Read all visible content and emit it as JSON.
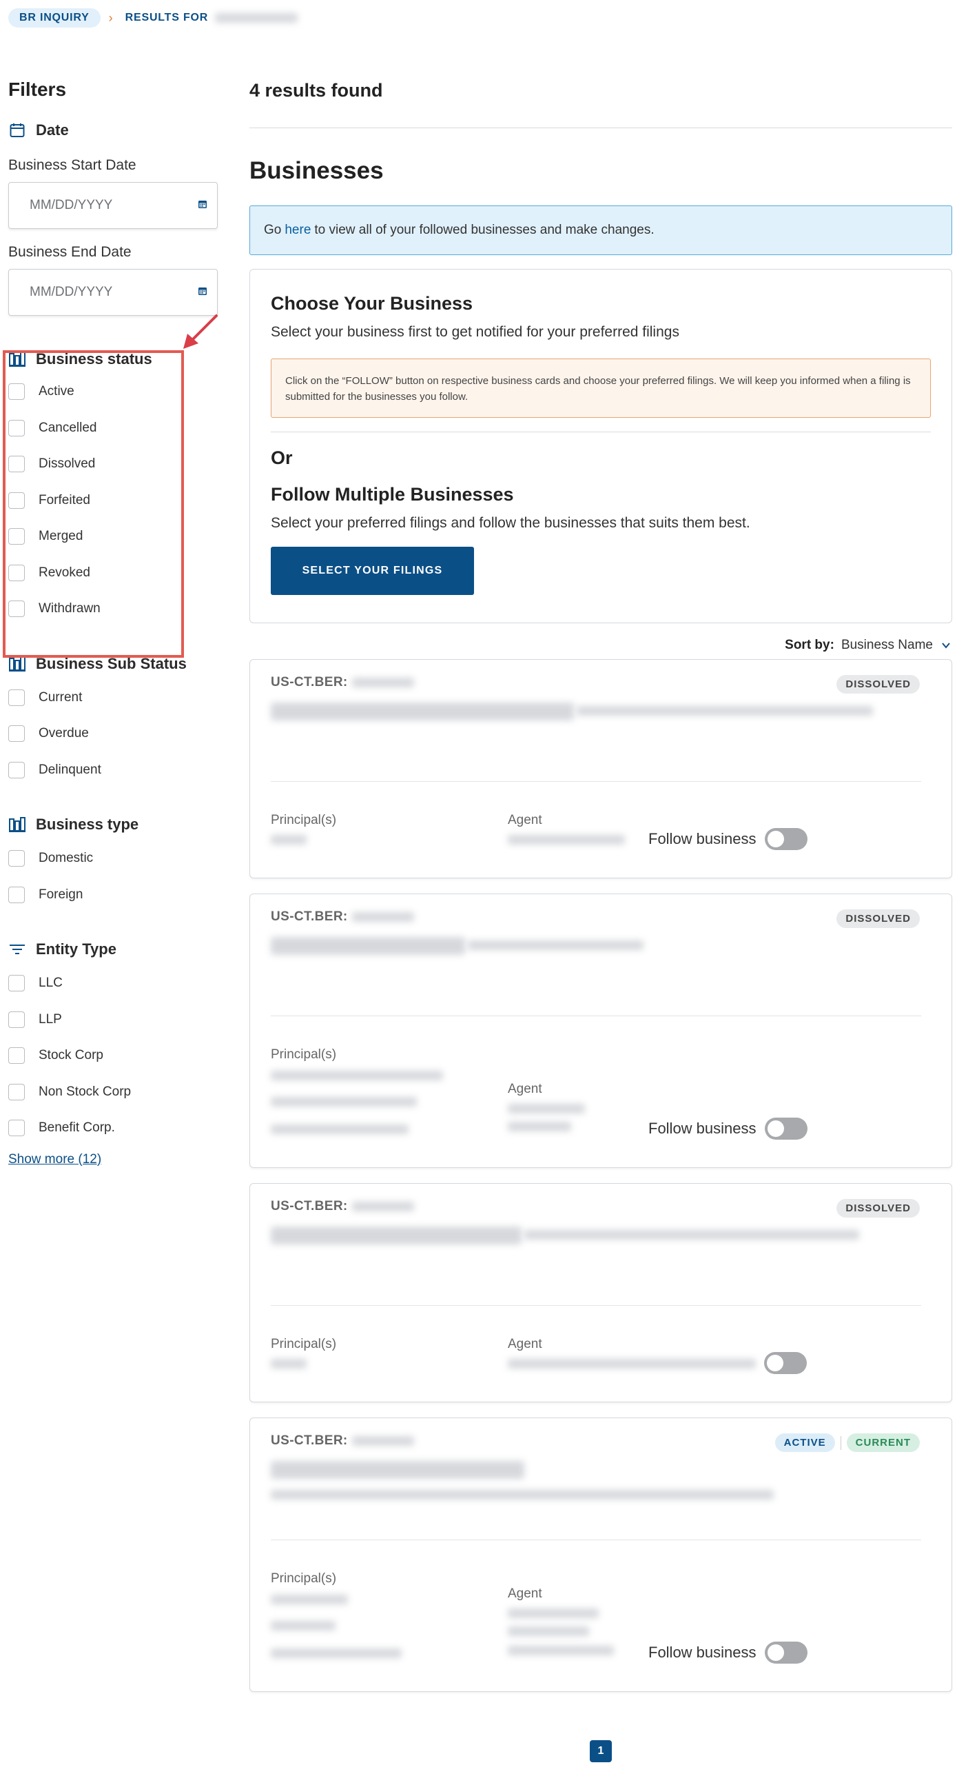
{
  "breadcrumb": {
    "home": "BR INQUIRY",
    "separator": "›",
    "current": "RESULTS FOR"
  },
  "filters": {
    "title": "Filters",
    "date": {
      "heading": "Date",
      "start_label": "Business Start Date",
      "start_placeholder": "MM/DD/YYYY",
      "end_label": "Business End Date",
      "end_placeholder": "MM/DD/YYYY"
    },
    "business_status": {
      "heading": "Business status",
      "options": [
        "Active",
        "Cancelled",
        "Dissolved",
        "Forfeited",
        "Merged",
        "Revoked",
        "Withdrawn"
      ]
    },
    "business_sub_status": {
      "heading": "Business Sub Status",
      "options": [
        "Current",
        "Overdue",
        "Delinquent"
      ]
    },
    "business_type": {
      "heading": "Business type",
      "options": [
        "Domestic",
        "Foreign"
      ]
    },
    "entity_type": {
      "heading": "Entity Type",
      "options": [
        "LLC",
        "LLP",
        "Stock Corp",
        "Non Stock Corp",
        "Benefit Corp."
      ]
    },
    "show_more": "Show more (12)"
  },
  "main": {
    "results_count": "4 results found",
    "section_title": "Businesses",
    "info": {
      "prefix": "Go",
      "link": "here",
      "suffix": "to view all of your followed businesses and make changes."
    },
    "choose": {
      "title": "Choose Your Business",
      "subtitle": "Select your business first to get notified for your preferred filings",
      "notice": "Click on the “FOLLOW” button on respective business cards and choose your preferred filings. We will keep you informed when a filing is submitted for the businesses you follow.",
      "or": "Or",
      "follow_title": "Follow Multiple Businesses",
      "follow_subtitle": "Select your preferred filings and follow the businesses that suits them best.",
      "button": "SELECT YOUR FILINGS"
    },
    "sort": {
      "label": "Sort by:",
      "value": "Business Name"
    },
    "cards": [
      {
        "id_prefix": "US-CT.BER:",
        "badges": [
          "DISSOLVED"
        ],
        "principals_label": "Principal(s)",
        "agent_label": "Agent",
        "follow_label": "Follow business"
      },
      {
        "id_prefix": "US-CT.BER:",
        "badges": [
          "DISSOLVED"
        ],
        "principals_label": "Principal(s)",
        "agent_label": "Agent",
        "follow_label": "Follow business"
      },
      {
        "id_prefix": "US-CT.BER:",
        "badges": [
          "DISSOLVED"
        ],
        "principals_label": "Principal(s)",
        "agent_label": "Agent",
        "follow_label": ""
      },
      {
        "id_prefix": "US-CT.BER:",
        "badges": [
          "ACTIVE",
          "CURRENT"
        ],
        "principals_label": "Principal(s)",
        "agent_label": "Agent",
        "follow_label": "Follow business"
      }
    ]
  },
  "pagination": {
    "current_page": "1"
  },
  "colors": {
    "primary": "#0b4f87",
    "highlight_box": "#e25b52",
    "info_bg": "#e0f1fb",
    "notice_bg": "#fdf4ec"
  }
}
